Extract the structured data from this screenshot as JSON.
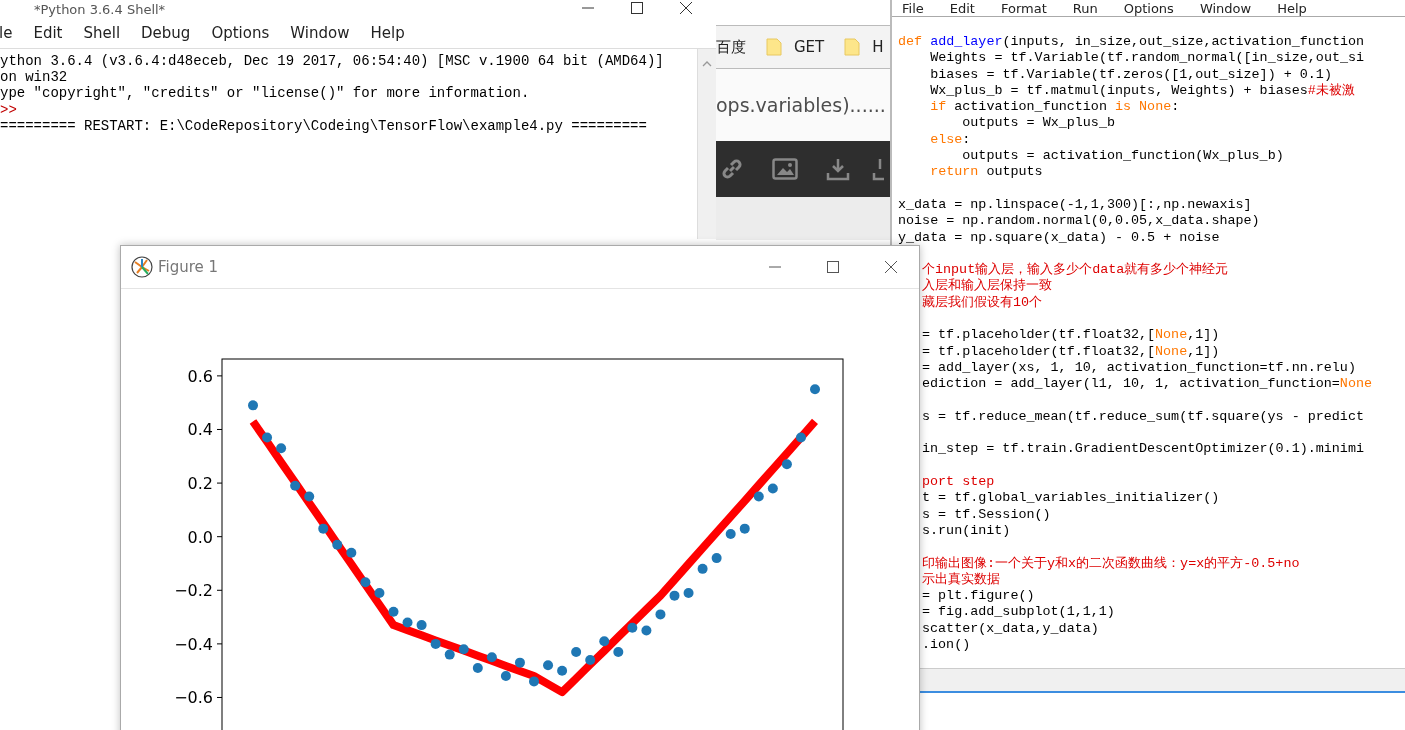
{
  "shell": {
    "title": "*Python 3.6.4 Shell*",
    "menu": [
      "le",
      "Edit",
      "Shell",
      "Debug",
      "Options",
      "Window",
      "Help"
    ],
    "lines": [
      {
        "kind": "output",
        "text": "ython 3.6.4 (v3.6.4:d48eceb, Dec 19 2017, 06:54:40) [MSC v.1900 64 bit (AMD64)]"
      },
      {
        "kind": "output",
        "text": "on win32"
      },
      {
        "kind": "output",
        "text": "ype \"copyright\", \"credits\" or \"license()\" for more information."
      },
      {
        "kind": "prompt",
        "text": ">>"
      },
      {
        "kind": "output",
        "text": "========= RESTART: E:\\CodeRepository\\Codeing\\TensorFlow\\example4.py ========="
      }
    ]
  },
  "browser": {
    "bookmarks": [
      {
        "label": "百度",
        "folder": false
      },
      {
        "label": "GET",
        "folder": true
      },
      {
        "label": "H",
        "folder": true
      }
    ],
    "heading": "ops.variables)......"
  },
  "editor": {
    "menu": [
      "File",
      "Edit",
      "Format",
      "Run",
      "Options",
      "Window",
      "Help"
    ],
    "lines": [
      {
        "gap": false,
        "segs": [
          {
            "kind": "keyword",
            "t": "def "
          },
          {
            "kind": "defname",
            "t": "add_layer"
          },
          {
            "kind": "plain",
            "t": "(inputs, in_size,out_size,activation_function"
          }
        ]
      },
      {
        "gap": false,
        "segs": [
          {
            "kind": "plain",
            "t": "    Weights = tf.Variable(tf.random_normal([in_size,out_si"
          }
        ]
      },
      {
        "gap": false,
        "segs": [
          {
            "kind": "plain",
            "t": "    biases = tf.Variable(tf.zeros([1,out_size]) + 0.1)"
          }
        ]
      },
      {
        "gap": false,
        "segs": [
          {
            "kind": "plain",
            "t": "    Wx_plus_b = tf.matmul(inputs, Weights) + biases"
          },
          {
            "kind": "comment",
            "t": "#未被激"
          }
        ]
      },
      {
        "gap": false,
        "segs": [
          {
            "kind": "keyword",
            "t": "    if"
          },
          {
            "kind": "plain",
            "t": " activation_function "
          },
          {
            "kind": "keyword",
            "t": "is None"
          },
          {
            "kind": "plain",
            "t": ":"
          }
        ]
      },
      {
        "gap": false,
        "segs": [
          {
            "kind": "plain",
            "t": "        outputs = Wx_plus_b"
          }
        ]
      },
      {
        "gap": false,
        "segs": [
          {
            "kind": "keyword",
            "t": "    else"
          },
          {
            "kind": "plain",
            "t": ":"
          }
        ]
      },
      {
        "gap": false,
        "segs": [
          {
            "kind": "plain",
            "t": "        outputs = activation_function(Wx_plus_b)"
          }
        ]
      },
      {
        "gap": false,
        "segs": [
          {
            "kind": "keyword",
            "t": "    return"
          },
          {
            "kind": "plain",
            "t": " outputs"
          }
        ]
      },
      {
        "gap": true,
        "segs": [
          {
            "kind": "plain",
            "t": "x_data = np.linspace(-1,1,300)[:,np.newaxis]"
          }
        ]
      },
      {
        "gap": false,
        "segs": [
          {
            "kind": "plain",
            "t": "noise = np.random.normal(0,0.05,x_data.shape)"
          }
        ]
      },
      {
        "gap": false,
        "segs": [
          {
            "kind": "plain",
            "t": "y_data = np.square(x_data) - 0.5 + noise"
          }
        ]
      }
    ],
    "covered_lines": [
      {
        "gap": true,
        "segs": [
          {
            "kind": "comment",
            "t": "个input输入层，输入多少个data就有多少个神经元"
          }
        ]
      },
      {
        "gap": false,
        "segs": [
          {
            "kind": "comment",
            "t": "入层和输入层保持一致"
          }
        ]
      },
      {
        "gap": false,
        "segs": [
          {
            "kind": "comment",
            "t": "藏层我们假设有10个"
          }
        ]
      },
      {
        "gap": true,
        "segs": [
          {
            "kind": "plain",
            "t": "= tf.placeholder(tf.float32,["
          },
          {
            "kind": "keyword",
            "t": "None"
          },
          {
            "kind": "plain",
            "t": ",1])"
          }
        ]
      },
      {
        "gap": false,
        "segs": [
          {
            "kind": "plain",
            "t": "= tf.placeholder(tf.float32,["
          },
          {
            "kind": "keyword",
            "t": "None"
          },
          {
            "kind": "plain",
            "t": ",1])"
          }
        ]
      },
      {
        "gap": false,
        "segs": [
          {
            "kind": "plain",
            "t": "= add_layer(xs, 1, 10, activation_function=tf.nn.relu)"
          }
        ]
      },
      {
        "gap": false,
        "segs": [
          {
            "kind": "plain",
            "t": "ediction = add_layer(l1, 10, 1, activation_function="
          },
          {
            "kind": "keyword",
            "t": "None"
          }
        ]
      },
      {
        "gap": true,
        "segs": [
          {
            "kind": "plain",
            "t": "s = tf.reduce_mean(tf.reduce_sum(tf.square(ys - predict"
          }
        ]
      },
      {
        "gap": true,
        "segs": [
          {
            "kind": "plain",
            "t": "in_step = tf.train.GradientDescentOptimizer(0.1).minimi"
          }
        ]
      },
      {
        "gap": true,
        "segs": [
          {
            "kind": "comment",
            "t": "port step"
          }
        ]
      },
      {
        "gap": false,
        "segs": [
          {
            "kind": "plain",
            "t": "t = tf.global_variables_initializer()"
          }
        ]
      },
      {
        "gap": false,
        "segs": [
          {
            "kind": "plain",
            "t": "s = tf.Session()"
          }
        ]
      },
      {
        "gap": false,
        "segs": [
          {
            "kind": "plain",
            "t": "s.run(init)"
          }
        ]
      },
      {
        "gap": true,
        "segs": [
          {
            "kind": "comment",
            "t": "印输出图像:一个关于y和x的二次函数曲线：y=x的平方-0.5+no"
          }
        ]
      },
      {
        "gap": false,
        "segs": [
          {
            "kind": "comment",
            "t": "示出真实数据"
          }
        ]
      },
      {
        "gap": false,
        "segs": [
          {
            "kind": "plain",
            "t": "= plt.figure()"
          }
        ]
      },
      {
        "gap": false,
        "segs": [
          {
            "kind": "plain",
            "t": "= fig.add_subplot(1,1,1)"
          }
        ]
      },
      {
        "gap": false,
        "segs": [
          {
            "kind": "plain",
            "t": "scatter(x_data,y_data)"
          }
        ]
      },
      {
        "gap": false,
        "segs": [
          {
            "kind": "plain",
            "t": ".ion()"
          }
        ]
      }
    ]
  },
  "figure": {
    "title": "Figure 1",
    "chart_data": {
      "type": "scatter",
      "ylim": [
        -0.8,
        0.663
      ],
      "yticks": [
        {
          "value": 0.6,
          "label": "0.6"
        },
        {
          "value": 0.4,
          "label": "0.4"
        },
        {
          "value": 0.2,
          "label": "0.2"
        },
        {
          "value": 0,
          "label": "0.0"
        },
        {
          "value": -0.2,
          "label": "−0.2"
        },
        {
          "value": -0.4,
          "label": "−0.4"
        },
        {
          "value": -0.6,
          "label": "−0.6"
        }
      ],
      "categories": [
        null,
        null,
        null,
        null,
        null,
        null,
        null,
        null,
        null,
        null,
        null,
        null,
        null,
        null,
        null,
        null,
        null,
        null,
        null,
        null,
        null,
        null,
        null,
        null,
        null,
        null,
        null,
        null,
        null,
        null,
        null,
        null,
        null,
        null,
        null,
        null,
        null,
        null,
        null,
        null,
        null
      ],
      "series": [
        {
          "type": "scatter",
          "color": "#1f77b4",
          "values": [
            0.49,
            0.37,
            0.33,
            0.19,
            0.15,
            0.03,
            -0.03,
            -0.06,
            -0.17,
            -0.21,
            -0.28,
            -0.32,
            -0.33,
            -0.4,
            -0.44,
            -0.42,
            -0.49,
            -0.45,
            -0.52,
            -0.47,
            -0.54,
            -0.48,
            -0.5,
            -0.43,
            -0.46,
            -0.39,
            -0.43,
            -0.34,
            -0.35,
            -0.29,
            -0.22,
            -0.21,
            -0.12,
            -0.08,
            0.01,
            0.03,
            0.15,
            0.18,
            0.27,
            0.37,
            0.55
          ]
        },
        {
          "type": "line",
          "color": "#ff0000",
          "values": [
            0.43,
            0.354,
            0.278,
            0.202,
            0.126,
            0.05,
            -0.026,
            -0.102,
            -0.178,
            -0.254,
            -0.33,
            -0.349,
            -0.368,
            -0.387,
            -0.406,
            -0.425,
            -0.444,
            -0.463,
            -0.482,
            -0.501,
            -0.52,
            -0.55,
            -0.58,
            -0.529,
            -0.477,
            -0.426,
            -0.374,
            -0.323,
            -0.271,
            -0.22,
            -0.161,
            -0.102,
            -0.043,
            0.016,
            0.075,
            0.134,
            0.193,
            0.252,
            0.311,
            0.371,
            0.43
          ]
        }
      ]
    }
  }
}
